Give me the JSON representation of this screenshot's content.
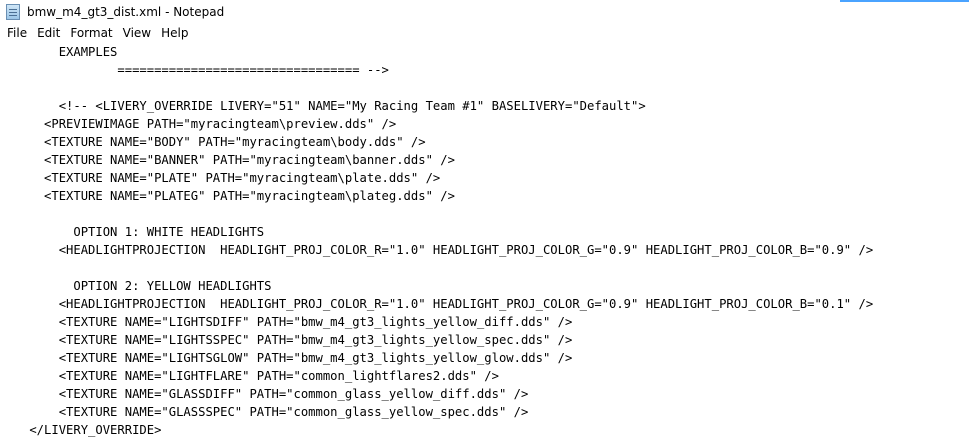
{
  "window": {
    "title": "bmw_m4_gt3_dist.xml - Notepad",
    "accent_color": "#4aa3ff"
  },
  "menu": [
    "File",
    "Edit",
    "Format",
    "View",
    "Help"
  ],
  "editor": {
    "lines": [
      "        EXAMPLES",
      "                ================================= -->",
      "",
      "        <!-- <LIVERY_OVERRIDE LIVERY=\"51\" NAME=\"My Racing Team #1\" BASELIVERY=\"Default\">",
      "      <PREVIEWIMAGE PATH=\"myracingteam\\preview.dds\" />",
      "      <TEXTURE NAME=\"BODY\" PATH=\"myracingteam\\body.dds\" />",
      "      <TEXTURE NAME=\"BANNER\" PATH=\"myracingteam\\banner.dds\" />",
      "      <TEXTURE NAME=\"PLATE\" PATH=\"myracingteam\\plate.dds\" />",
      "      <TEXTURE NAME=\"PLATEG\" PATH=\"myracingteam\\plateg.dds\" />",
      "",
      "          OPTION 1: WHITE HEADLIGHTS",
      "        <HEADLIGHTPROJECTION  HEADLIGHT_PROJ_COLOR_R=\"1.0\" HEADLIGHT_PROJ_COLOR_G=\"0.9\" HEADLIGHT_PROJ_COLOR_B=\"0.9\" />",
      "",
      "          OPTION 2: YELLOW HEADLIGHTS",
      "        <HEADLIGHTPROJECTION  HEADLIGHT_PROJ_COLOR_R=\"1.0\" HEADLIGHT_PROJ_COLOR_G=\"0.9\" HEADLIGHT_PROJ_COLOR_B=\"0.1\" />",
      "        <TEXTURE NAME=\"LIGHTSDIFF\" PATH=\"bmw_m4_gt3_lights_yellow_diff.dds\" />",
      "        <TEXTURE NAME=\"LIGHTSSPEC\" PATH=\"bmw_m4_gt3_lights_yellow_spec.dds\" />",
      "        <TEXTURE NAME=\"LIGHTSGLOW\" PATH=\"bmw_m4_gt3_lights_yellow_glow.dds\" />",
      "        <TEXTURE NAME=\"LIGHTFLARE\" PATH=\"common_lightflares2.dds\" />",
      "        <TEXTURE NAME=\"GLASSDIFF\" PATH=\"common_glass_yellow_diff.dds\" />",
      "        <TEXTURE NAME=\"GLASSSPEC\" PATH=\"common_glass_yellow_spec.dds\" />",
      "    </LIVERY_OVERRIDE>"
    ]
  }
}
